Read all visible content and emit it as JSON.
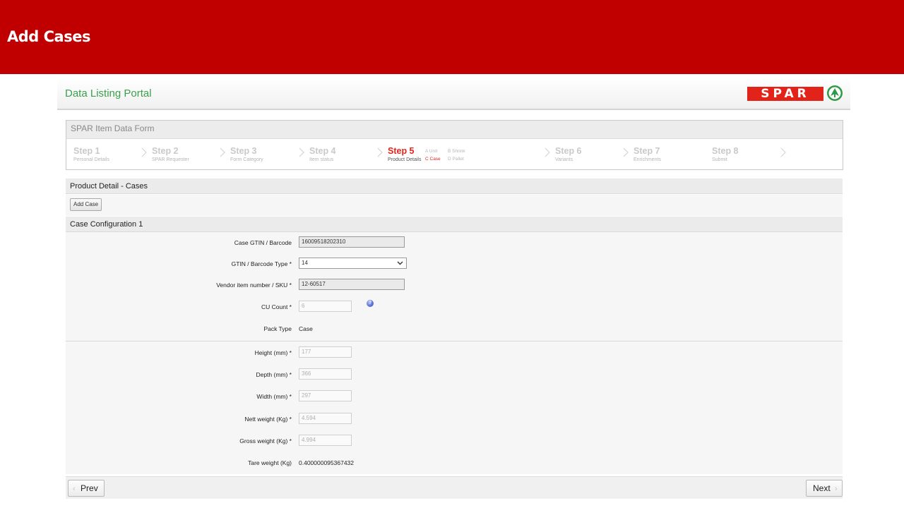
{
  "banner": {
    "title": "Add Cases",
    "color": "#c00000"
  },
  "header": {
    "portal_title": "Data Listing Portal",
    "logo_text": "SPAR"
  },
  "form": {
    "title": "SPAR Item Data Form",
    "steps": [
      {
        "title": "Step 1",
        "sub": "Personal Details",
        "active": false
      },
      {
        "title": "Step 2",
        "sub": "SPAR Requester",
        "active": false
      },
      {
        "title": "Step 3",
        "sub": "Form Category",
        "active": false
      },
      {
        "title": "Step 4",
        "sub": "Item status",
        "active": false
      },
      {
        "title": "Step 5",
        "sub": "Product Details",
        "active": true
      },
      {
        "title": "Step 6",
        "sub": "Variants",
        "active": false
      },
      {
        "title": "Step 7",
        "sub": "Enrichments",
        "active": false
      },
      {
        "title": "Step 8",
        "sub": "Submit",
        "active": false
      }
    ],
    "step5_options": {
      "a": "A Unit",
      "b": "B Shrink",
      "c": "C Case",
      "d": "D Pallet",
      "selected": "C Case"
    }
  },
  "product_detail": {
    "title": "Product Detail - Cases",
    "add_case_label": "Add Case"
  },
  "case_config": {
    "title": "Case Configuration 1",
    "gtin": {
      "label": "Case GTIN / Barcode",
      "value": "16009518202310"
    },
    "gtin_type": {
      "label": "GTIN / Barcode Type *",
      "value": "14"
    },
    "vendor_sku": {
      "label": "Vendor item number / SKU *",
      "value": "12-60517"
    },
    "cu_count": {
      "label": "CU Count *",
      "value": "6"
    },
    "pack_type": {
      "label": "Pack Type",
      "value": "Case"
    },
    "height": {
      "label": "Height (mm) *",
      "value": "177"
    },
    "depth": {
      "label": "Depth (mm) *",
      "value": "366"
    },
    "width": {
      "label": "Width (mm) *",
      "value": "297"
    },
    "nett_weight": {
      "label": "Nett weight (Kg) *",
      "value": "4.594"
    },
    "gross_weight": {
      "label": "Gross weight (Kg) *",
      "value": "4.994"
    },
    "tare_weight": {
      "label": "Tare weight (Kg)",
      "value": "0.400000095367432"
    }
  },
  "nav": {
    "prev_label": "Prev",
    "next_label": "Next"
  }
}
